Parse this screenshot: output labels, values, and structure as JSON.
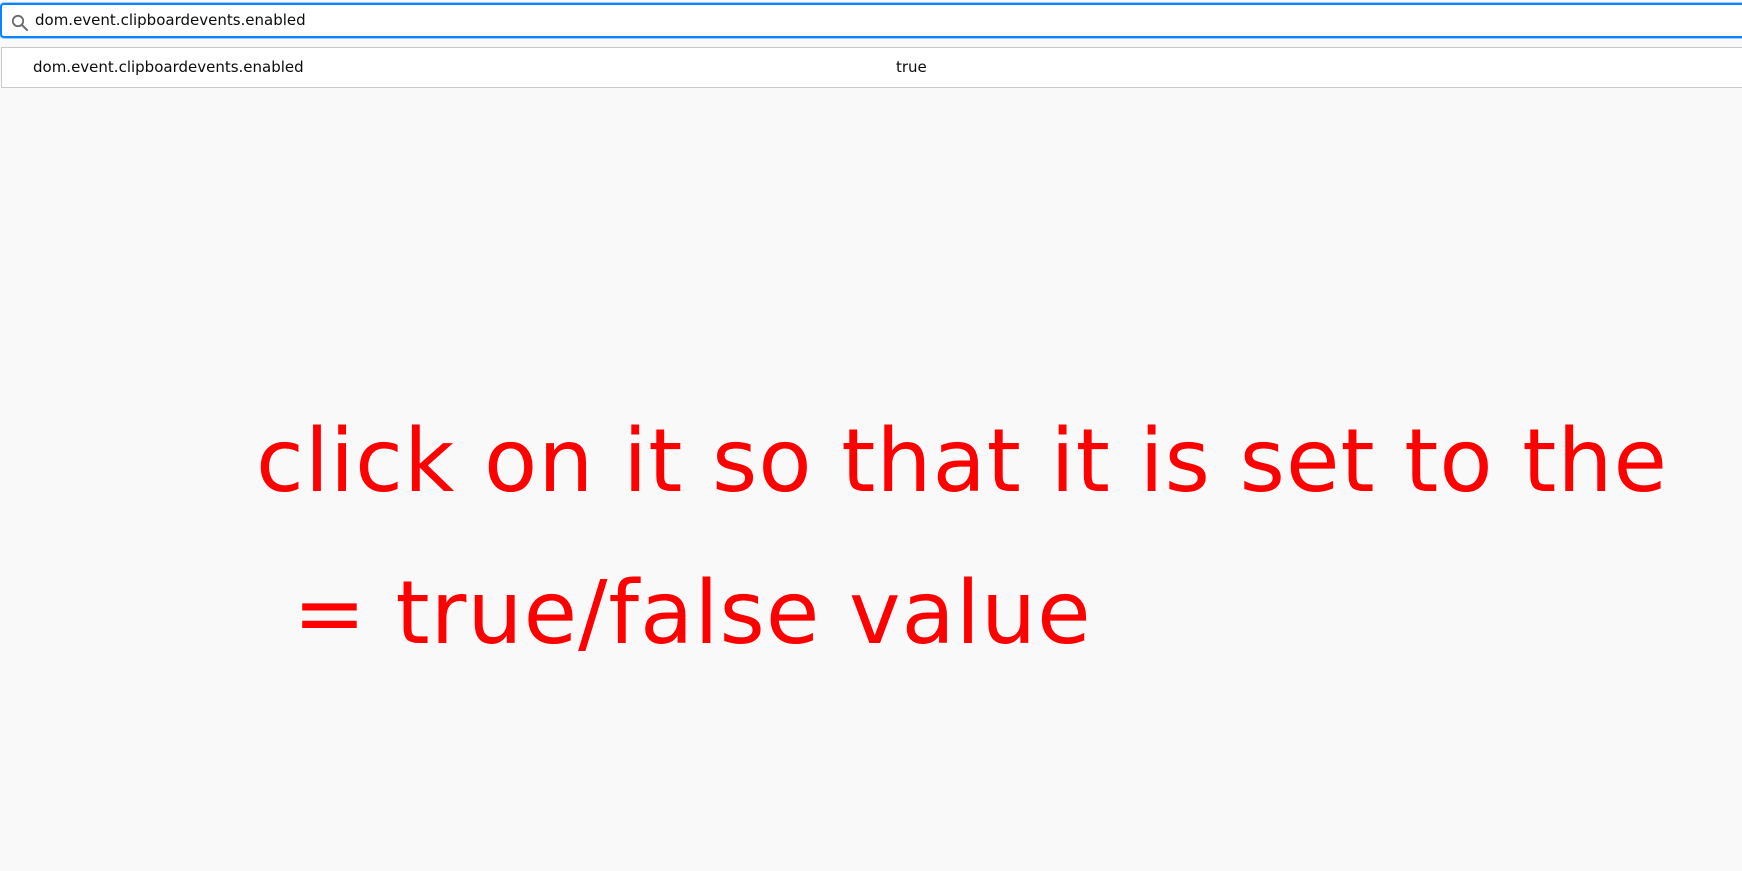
{
  "search": {
    "value": "dom.event.clipboardevents.enabled",
    "icon": "search-icon"
  },
  "prefs": [
    {
      "name": "dom.event.clipboardevents.enabled",
      "value": "true"
    }
  ],
  "annotation": {
    "line1": "click on it so that it is set to the",
    "line2": "= true/false value",
    "color": "#ff0000"
  },
  "colors": {
    "focus_border": "#0a84ff",
    "background": "#f9f9f9"
  }
}
